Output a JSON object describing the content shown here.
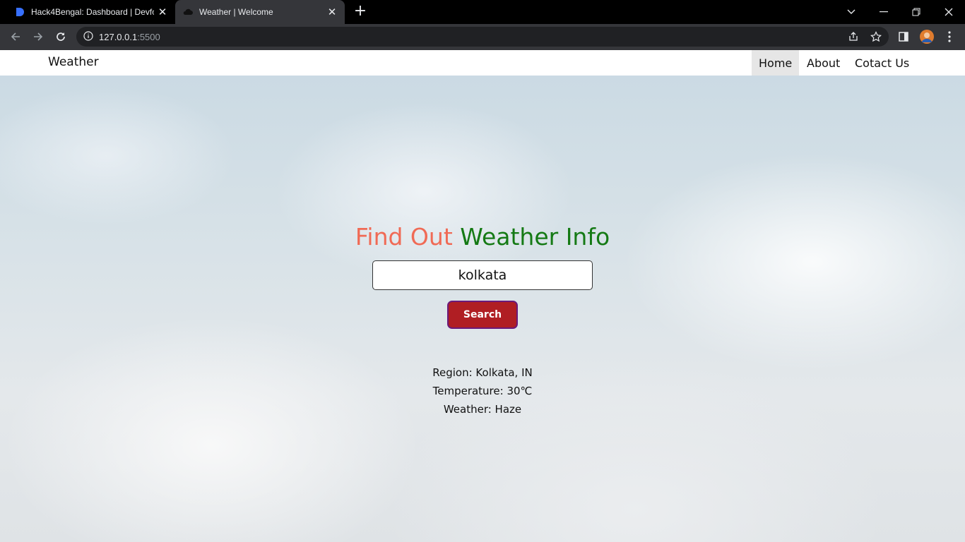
{
  "browser": {
    "tabs": [
      {
        "title": "Hack4Bengal: Dashboard | Devfo",
        "favicon": "devfolio-icon"
      },
      {
        "title": "Weather | Welcome",
        "favicon": "cloud-icon"
      }
    ],
    "address": {
      "host": "127.0.0.1",
      "port": ":5500"
    }
  },
  "navbar": {
    "brand": "Weather",
    "links": [
      {
        "label": "Home",
        "active": true
      },
      {
        "label": "About",
        "active": false
      },
      {
        "label": "Cotact Us",
        "active": false
      }
    ]
  },
  "hero": {
    "title_part1": "Find Out",
    "title_part2": "Weather Info",
    "title_part1_color": "#f06a55",
    "title_part2_color": "#157a15"
  },
  "search": {
    "value": "kolkata",
    "button_label": "Search",
    "button_color": "#b01e23"
  },
  "result": {
    "region": "Region: Kolkata, IN",
    "temperature": "Temperature: 30℃",
    "weather": "Weather: Haze"
  }
}
